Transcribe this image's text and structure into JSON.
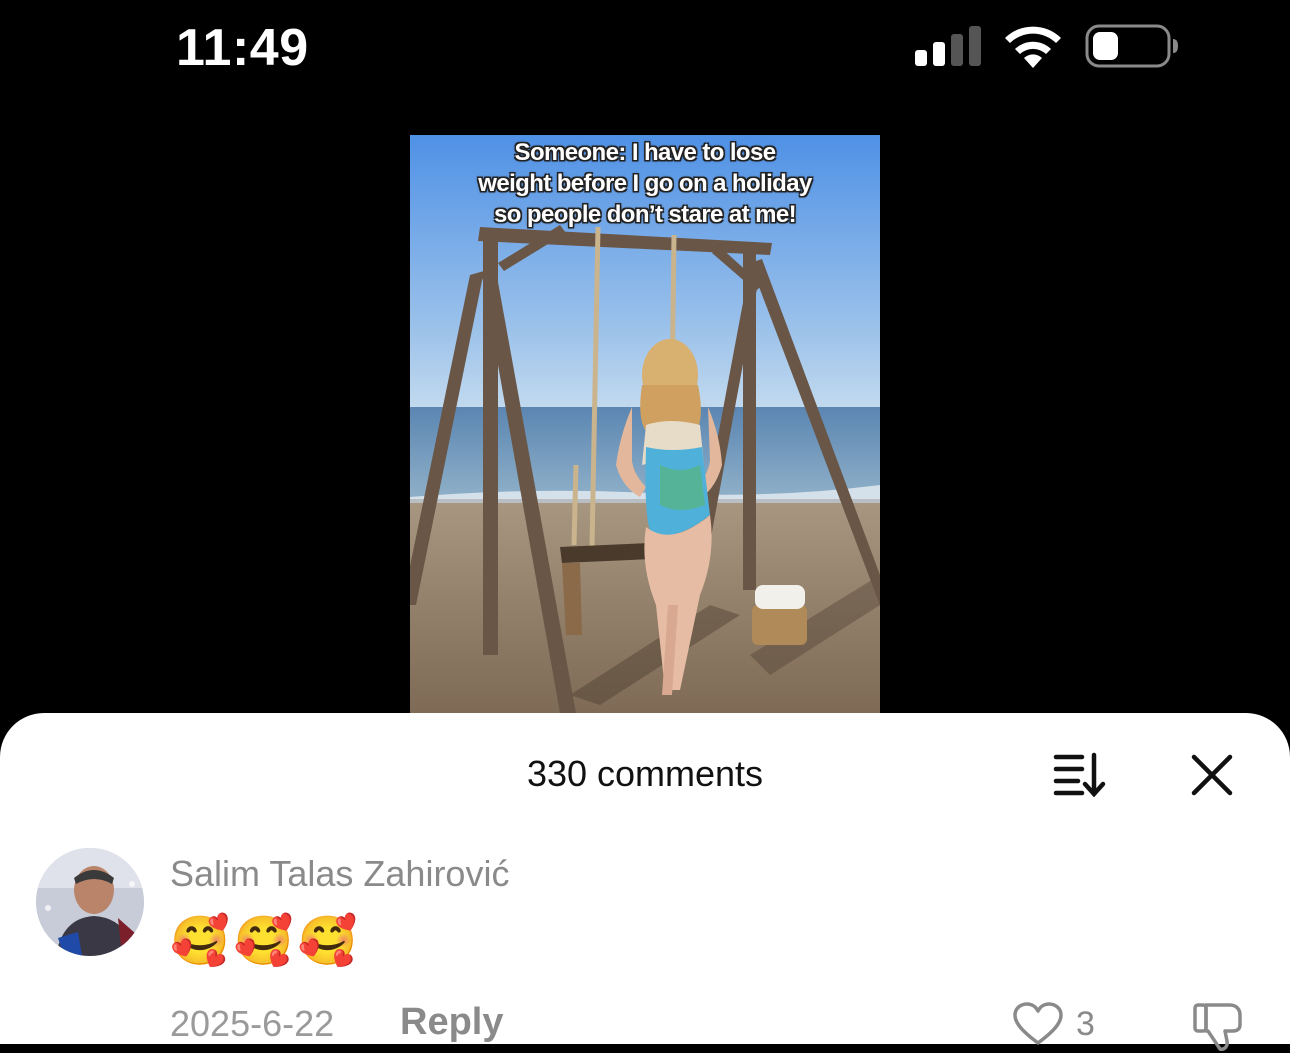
{
  "status_bar": {
    "time": "11:49",
    "signal_icon": "cellular-signal-icon",
    "wifi_icon": "wifi-icon",
    "battery_icon": "battery-icon",
    "battery_level": 0.35
  },
  "video": {
    "caption": "Someone: I have to lose\nweight before I go on a holiday\nso people don’t stare at me!"
  },
  "comments_sheet": {
    "title": "330 comments",
    "sort_icon": "sort-icon",
    "close_icon": "close-icon",
    "comments": [
      {
        "author": "Salim Talas Zahirović",
        "text": "🥰🥰🥰",
        "date": "2025-6-22",
        "reply_label": "Reply",
        "like_count": "3",
        "like_icon": "heart-icon",
        "dislike_icon": "thumbs-down-icon"
      }
    ]
  }
}
